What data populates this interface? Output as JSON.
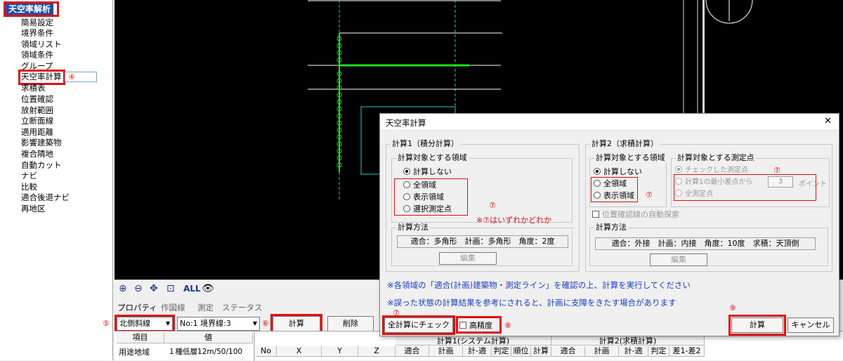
{
  "sidebar": {
    "title": "天空率解析",
    "items": [
      "簡易設定",
      "境界条件",
      "領域リスト",
      "領域条件",
      "グループ",
      "天空率計算",
      "求積表",
      "位置確認",
      "放射範囲",
      "立断面線",
      "適用距離",
      "影響建築物",
      "複合隣地",
      "自動カット",
      "ナビ",
      "比較",
      "適合後退ナビ",
      "再地区"
    ],
    "marker": "④"
  },
  "toolbar": {
    "icons": [
      "zoom-in-icon",
      "zoom-out-icon",
      "pan-icon",
      "zoom-fit-icon",
      "all-label",
      "eye-icon"
    ],
    "all_label": "ALL"
  },
  "tabs": [
    "プロパティ",
    "作図線",
    "測定",
    "ステータス"
  ],
  "controls": {
    "marker5": "⑤",
    "marker6": "⑥",
    "slope_select": "北側斜線",
    "boundary_select": "No:1 境界線:3",
    "calc_button": "計算",
    "delete_button": "削除"
  },
  "property_table": {
    "headers": [
      "項目",
      "値"
    ],
    "row": [
      "用途地域",
      "１種低層12m/50/100"
    ]
  },
  "result_grid": {
    "group1": "計算1(システム計算)",
    "group2": "計算2(求積計算)",
    "headers": [
      "No",
      "X",
      "Y",
      "Z",
      "適合",
      "計画",
      "計-適",
      "判定",
      "順位",
      "計算",
      "適合",
      "計画",
      "計-適",
      "判定",
      "差1-差2"
    ]
  },
  "dialog": {
    "title": "天空率計算",
    "close": "✕",
    "calc1": {
      "title": "計算1（積分計算）",
      "area_group": "計算対象とする領域",
      "options": [
        "計算しない",
        "全領域",
        "表示領域",
        "選択測定点"
      ],
      "selected": 0,
      "hint": "※⑦はいずれかどれか",
      "marker": "⑦",
      "method_title": "計算方法",
      "method": "適合：多角形　計画：多角形　角度：2度",
      "edit": "編集"
    },
    "calc2": {
      "title": "計算2（求積計算）",
      "area_group": "計算対象とする領域",
      "options": [
        "計算しない",
        "全領域",
        "表示領域"
      ],
      "selected": 0,
      "marker": "⑦",
      "point_group": "計算対象とする測定点",
      "point_options": [
        "チェックした測定点",
        "計算1の最小差点から",
        "全測定点"
      ],
      "point_count": "3",
      "point_unit": "ポイント",
      "point_marker": "⑦",
      "auto_search": "位置確認線の自動探索",
      "method_title": "計算方法",
      "method": "適合：外接　計画：内接　角度：10度　求積：天頂側",
      "edit": "編集"
    },
    "note1": "※各領域の「適合(計画)建築物・測定ライン」を確認の上、計算を実行してください",
    "note2": "※誤った状態の計算結果を参考にされると、計画に支障をきたす場合があります",
    "check_all_button": "全計算にチェック",
    "check_all_marker": "⑦",
    "high_precision": "高精度",
    "high_precision_marker": "⑧",
    "calc_button": "計算",
    "calc_marker": "⑨",
    "cancel_button": "キャンセル"
  },
  "colors": {
    "annotation_red": "#e01010",
    "note_blue": "#1a3cc8",
    "sidebar_highlight": "#1c4e9e",
    "drawing_green": "#22dd22",
    "drawing_cyan": "#22cccc"
  }
}
